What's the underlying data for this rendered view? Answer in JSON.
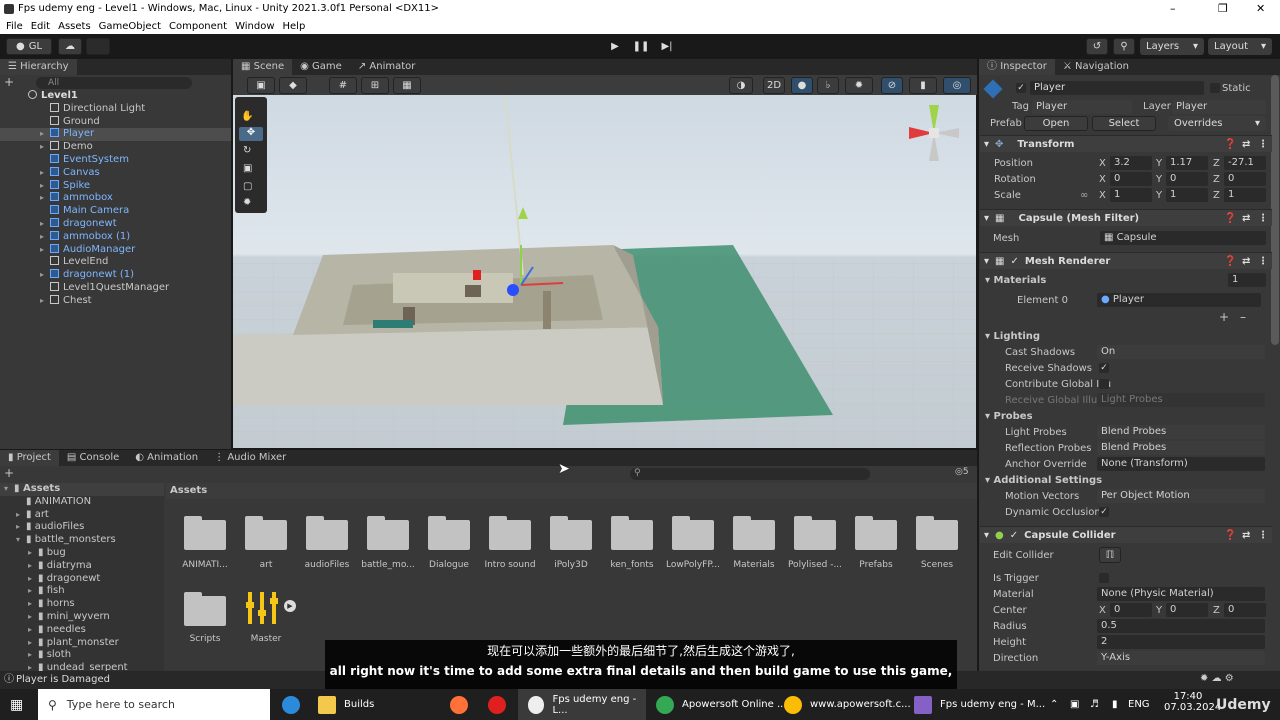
{
  "window": {
    "title": "Fps udemy eng - Level1 - Windows, Mac, Linux - Unity 2021.3.0f1 Personal <DX11>"
  },
  "menu": [
    "File",
    "Edit",
    "Assets",
    "GameObject",
    "Component",
    "Window",
    "Help"
  ],
  "toolbar": {
    "account": "GL",
    "layers": "Layers",
    "layout": "Layout"
  },
  "hierarchy": {
    "tab": "Hierarchy",
    "search_placeholder": "All",
    "scene": "Level1",
    "items": [
      {
        "label": "Directional Light"
      },
      {
        "label": "Ground"
      },
      {
        "label": "Player"
      },
      {
        "label": "Demo"
      },
      {
        "label": "EventSystem"
      },
      {
        "label": "Canvas"
      },
      {
        "label": "Spike"
      },
      {
        "label": "ammobox"
      },
      {
        "label": "Main Camera"
      },
      {
        "label": "dragonewt"
      },
      {
        "label": "ammobox (1)"
      },
      {
        "label": "AudioManager"
      },
      {
        "label": "LevelEnd"
      },
      {
        "label": "dragonewt (1)"
      },
      {
        "label": "Level1QuestManager"
      },
      {
        "label": "Chest"
      }
    ]
  },
  "scene_tabs": [
    "Scene",
    "Game",
    "Animator"
  ],
  "scene_toolbar": {
    "mode2d": "2D"
  },
  "bottom_tabs": [
    "Project",
    "Console",
    "Animation",
    "Audio Mixer"
  ],
  "project": {
    "tree_root": "Assets",
    "tree": [
      "ANIMATION",
      "art",
      "audioFiles",
      "battle_monsters",
      "bug",
      "diatryma",
      "dragonewt",
      "fish",
      "horns",
      "mini_wyvern",
      "needles",
      "plant_monster",
      "sloth",
      "undead_serpent"
    ],
    "breadcrumb": "Assets",
    "visible_count": "5",
    "assets": [
      "ANIMATI...",
      "art",
      "audioFiles",
      "battle_mo...",
      "Dialogue",
      "Intro sound",
      "iPoly3D",
      "ken_fonts",
      "LowPolyFP...",
      "Materials",
      "Polylised -...",
      "Prefabs",
      "Scenes",
      "Scripts",
      "Master"
    ]
  },
  "inspector": {
    "tabs": [
      "Inspector",
      "Navigation"
    ],
    "object_name": "Player",
    "static_label": "Static",
    "tag_label": "Tag",
    "tag": "Player",
    "layer_label": "Layer",
    "layer": "Player",
    "prefab_label": "Prefab",
    "open": "Open",
    "select": "Select",
    "overrides": "Overrides",
    "transform": {
      "title": "Transform",
      "position_label": "Position",
      "rotation_label": "Rotation",
      "scale_label": "Scale",
      "position": {
        "x": "3.2",
        "y": "1.17",
        "z": "-27.1"
      },
      "rotation": {
        "x": "0",
        "y": "0",
        "z": "0"
      },
      "scale": {
        "x": "1",
        "y": "1",
        "z": "1"
      }
    },
    "mesh_filter": {
      "title": "Capsule (Mesh Filter)",
      "mesh_label": "Mesh",
      "mesh": "Capsule"
    },
    "mesh_renderer": {
      "title": "Mesh Renderer",
      "materials_label": "Materials",
      "materials_count": "1",
      "element0_label": "Element 0",
      "element0": "Player",
      "lighting_label": "Lighting",
      "cast_shadows_label": "Cast Shadows",
      "cast_shadows": "On",
      "receive_shadows_label": "Receive Shadows",
      "contribute_gi_label": "Contribute Global Illu",
      "receive_gi_label": "Receive Global Illum",
      "receive_gi": "Light Probes",
      "probes_label": "Probes",
      "light_probes_label": "Light Probes",
      "light_probes": "Blend Probes",
      "reflection_probes_label": "Reflection Probes",
      "reflection_probes": "Blend Probes",
      "anchor_label": "Anchor Override",
      "anchor": "None (Transform)",
      "additional_label": "Additional Settings",
      "motion_vectors_label": "Motion Vectors",
      "motion_vectors": "Per Object Motion",
      "dynamic_occlusion_label": "Dynamic Occlusion"
    },
    "capsule_collider": {
      "title": "Capsule Collider",
      "edit_label": "Edit Collider",
      "trigger_label": "Is Trigger",
      "material_label": "Material",
      "material": "None (Physic Material)",
      "center_label": "Center",
      "center": {
        "x": "0",
        "y": "0",
        "z": "0"
      },
      "radius_label": "Radius",
      "radius": "0.5",
      "height_label": "Height",
      "height": "2",
      "direction_label": "Direction",
      "direction": "Y-Axis"
    }
  },
  "status": "Player is Damaged",
  "subtitles": {
    "zh": "现在可以添加一些额外的最后细节了,然后生成这个游戏了,",
    "en": "all right now it's time to add some extra final details and then build game to use this game,"
  },
  "taskbar": {
    "search": "Type here to search",
    "items": [
      "Builds",
      "Fps udemy eng - L...",
      "Apowersoft Online ...",
      "www.apowersoft.c...",
      "Fps udemy eng - M..."
    ],
    "lang": "ENG",
    "time": "17:40",
    "date": "07.03.2024",
    "watermark": "Udemy"
  },
  "colors": {
    "accent": "#2c5d87",
    "panel": "#383838",
    "scene_ground": "#2e7d5e"
  }
}
